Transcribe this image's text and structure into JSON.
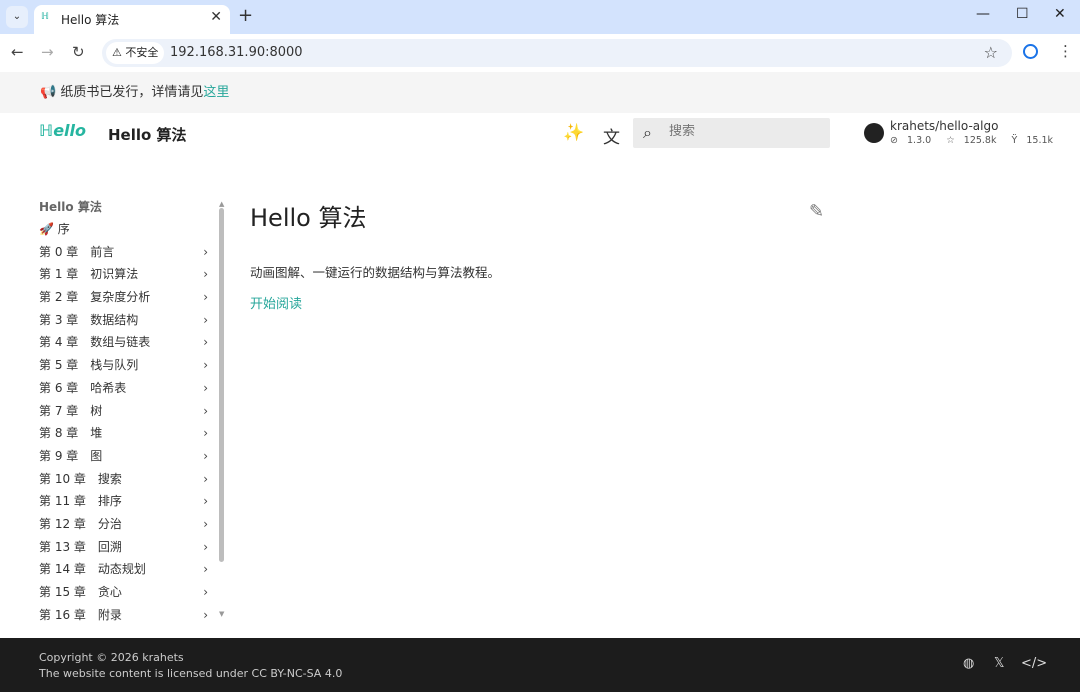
{
  "browser": {
    "tab_title": "Hello 算法",
    "favicon": "hello-algo-logo",
    "security_label": "不安全",
    "url": "192.168.31.90:8000"
  },
  "announcement": {
    "text": "纸质书已发行，详情请见",
    "link": "这里"
  },
  "header": {
    "site_title": "Hello 算法",
    "search_placeholder": "搜索",
    "repo": {
      "name": "krahets/hello-algo",
      "version": "1.3.0",
      "stars": "125.8k",
      "forks": "15.1k"
    }
  },
  "sidebar": {
    "title": "Hello 算法",
    "items": [
      {
        "label": "序",
        "icon": "rocket-icon"
      },
      {
        "label": "第 0 章　前言"
      },
      {
        "label": "第 1 章　初识算法"
      },
      {
        "label": "第 2 章　复杂度分析"
      },
      {
        "label": "第 3 章　数据结构"
      },
      {
        "label": "第 4 章　数组与链表"
      },
      {
        "label": "第 5 章　栈与队列"
      },
      {
        "label": "第 6 章　哈希表"
      },
      {
        "label": "第 7 章　树"
      },
      {
        "label": "第 8 章　堆"
      },
      {
        "label": "第 9 章　图"
      },
      {
        "label": "第 10 章　搜索"
      },
      {
        "label": "第 11 章　排序"
      },
      {
        "label": "第 12 章　分治"
      },
      {
        "label": "第 13 章　回溯"
      },
      {
        "label": "第 14 章　动态规划"
      },
      {
        "label": "第 15 章　贪心"
      },
      {
        "label": "第 16 章　附录"
      }
    ]
  },
  "main": {
    "title": "Hello 算法",
    "description": "动画图解、一键运行的数据结构与算法教程。",
    "start_link": "开始阅读"
  },
  "footer": {
    "copyright": "Copyright © 2026 krahets",
    "license": "The website content is licensed under CC BY-NC-SA 4.0"
  },
  "colors": {
    "accent": "#26a69a",
    "footer_bg": "#1c1c1c",
    "tabbar_bg": "#d3e3fd"
  }
}
